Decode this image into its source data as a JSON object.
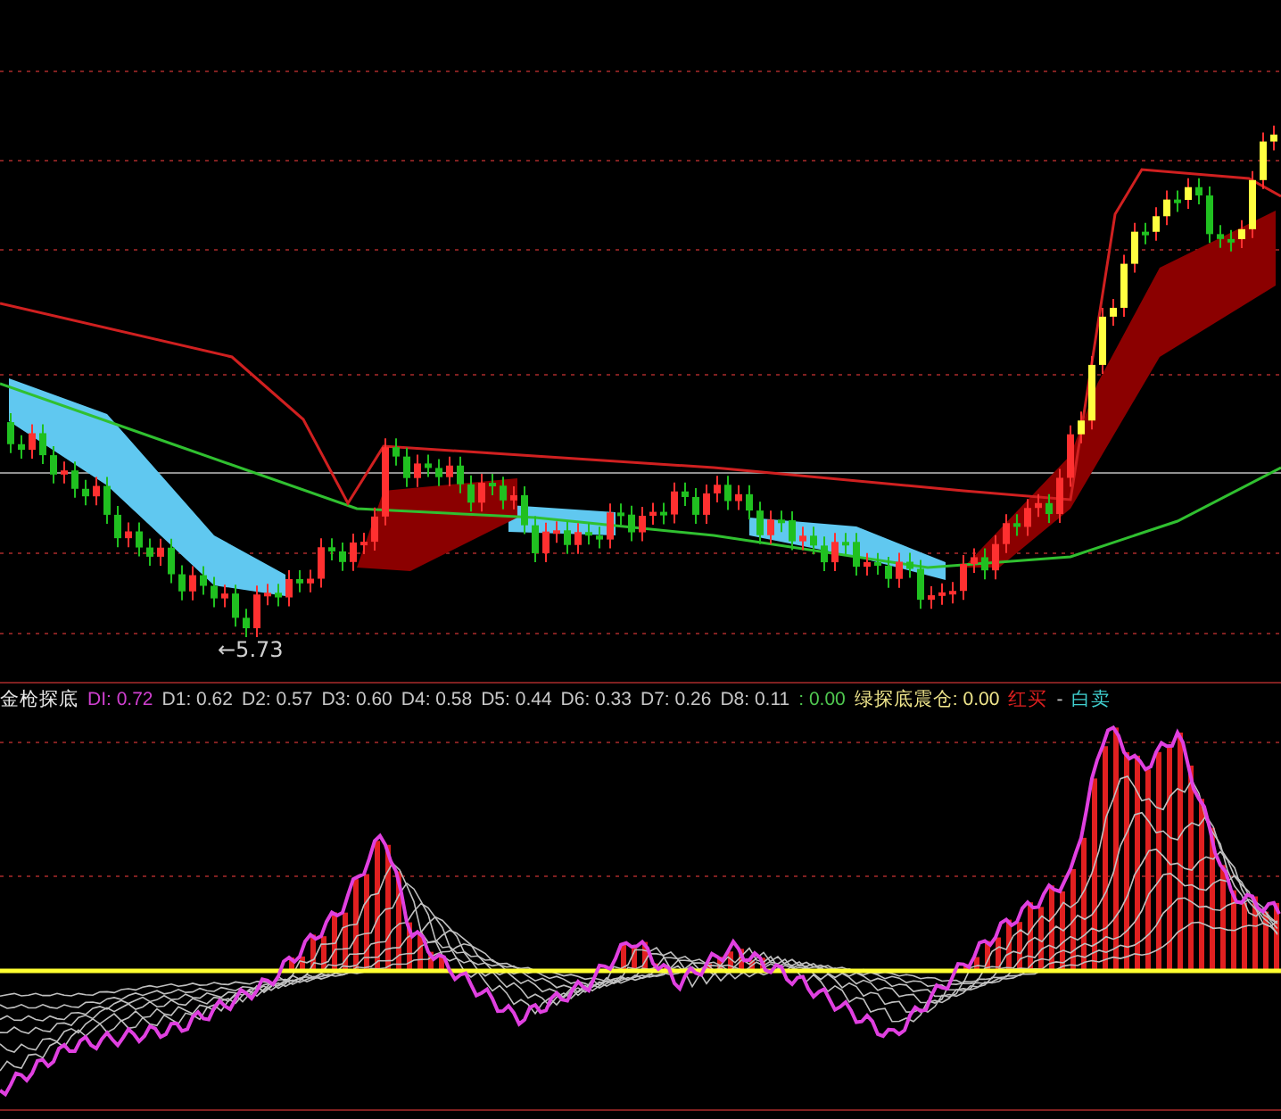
{
  "main_chart": {
    "low_label": "←5.73"
  },
  "indicator": {
    "legend": [
      {
        "text": "金枪探底",
        "color": "#e8e8e8"
      },
      {
        "text": "DI: 0.72",
        "color": "#d040d0"
      },
      {
        "text": "D1: 0.62",
        "color": "#c8c8c8"
      },
      {
        "text": "D2: 0.57",
        "color": "#c8c8c8"
      },
      {
        "text": "D3: 0.60",
        "color": "#c8c8c8"
      },
      {
        "text": "D4: 0.58",
        "color": "#c8c8c8"
      },
      {
        "text": "D5: 0.44",
        "color": "#c8c8c8"
      },
      {
        "text": "D6: 0.33",
        "color": "#c8c8c8"
      },
      {
        "text": "D7: 0.26",
        "color": "#c8c8c8"
      },
      {
        "text": "D8: 0.11",
        "color": "#c8c8c8"
      },
      {
        "text": ": 0.00",
        "color": "#50c850"
      },
      {
        "text": "绿探底震仓: 0.00",
        "color": "#f0e68c"
      },
      {
        "text": "红买",
        "color": "#e02020"
      },
      {
        "text": "-",
        "color": "#c8c8c8"
      },
      {
        "text": "白卖",
        "color": "#40d0d0"
      }
    ]
  }
}
